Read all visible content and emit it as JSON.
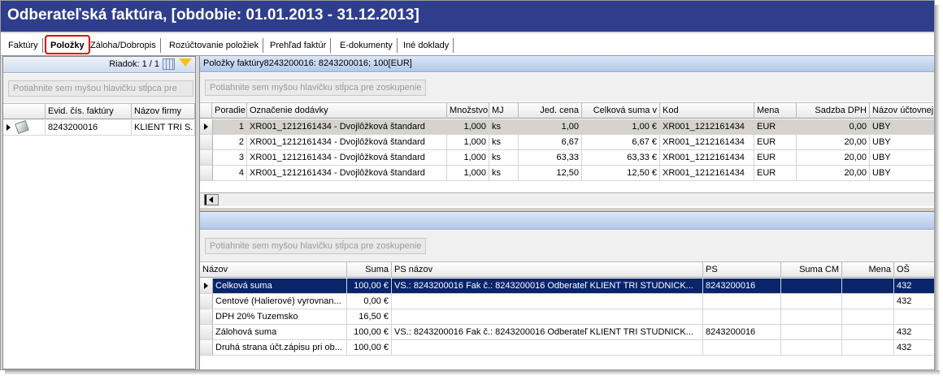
{
  "window": {
    "title": "Odberateľská faktúra, [obdobie: 01.01.2013 - 31.12.2013]"
  },
  "tabs": [
    "Faktúry",
    "Položky",
    "Záloha/Dobropis",
    "Rozúčtovanie položiek",
    "Prehľad faktúr",
    "E-dokumenty",
    "Iné doklady"
  ],
  "active_tab": "Položky",
  "left_panel": {
    "row_counter": "Riadok: 1 / 1",
    "group_placeholder": "Potiahnite sem myšou hlavičku stĺpca pre",
    "columns": [
      "Evid. čís. faktúry",
      "Názov firmy"
    ],
    "rows": [
      {
        "evid": "8243200016",
        "firma": "KLIENT TRI S."
      }
    ]
  },
  "items_panel": {
    "header": "Položky faktúry8243200016: 8243200016; 100[EUR]",
    "group_placeholder": "Potiahnite sem myšou hlavičku stĺpca pre zoskupenie",
    "columns": [
      "Poradie",
      "Označenie dodávky",
      "Množstvo",
      "MJ",
      "Jed. cena",
      "Celková suma v",
      "Kod",
      "Mena",
      "Sadzba DPH",
      "Názov účtovnej"
    ],
    "rows": [
      {
        "poradie": "1",
        "oznacenie": "XR001_1212161434 - Dvojlôžková štandard",
        "mnozstvo": "1,000",
        "mj": "ks",
        "jed_cena": "1,00",
        "celkova": "1,00 €",
        "kod": "XR001_1212161434",
        "mena": "EUR",
        "sadzba": "0,00",
        "nazov": "UBY"
      },
      {
        "poradie": "2",
        "oznacenie": "XR001_1212161434 - Dvojlôžková štandard",
        "mnozstvo": "1,000",
        "mj": "ks",
        "jed_cena": "6,67",
        "celkova": "6,67 €",
        "kod": "XR001_1212161434",
        "mena": "EUR",
        "sadzba": "20,00",
        "nazov": "UBY"
      },
      {
        "poradie": "3",
        "oznacenie": "XR001_1212161434 - Dvojlôžková štandard",
        "mnozstvo": "1,000",
        "mj": "ks",
        "jed_cena": "63,33",
        "celkova": "63,33 €",
        "kod": "XR001_1212161434",
        "mena": "EUR",
        "sadzba": "20,00",
        "nazov": "UBY"
      },
      {
        "poradie": "4",
        "oznacenie": "XR001_1212161434 - Dvojlôžková štandard",
        "mnozstvo": "1,000",
        "mj": "ks",
        "jed_cena": "12,50",
        "celkova": "12,50 €",
        "kod": "XR001_1212161434",
        "mena": "EUR",
        "sadzba": "20,00",
        "nazov": "UBY"
      }
    ]
  },
  "summary_panel": {
    "group_placeholder": "Potiahnite sem myšou hlavičku stĺpca pre zoskupenie",
    "columns": [
      "Názov",
      "Suma",
      "PS názov",
      "PS",
      "Suma CM",
      "Mena",
      "OŠ"
    ],
    "rows": [
      {
        "nazov": "Celková suma",
        "suma": "100,00 €",
        "ps_nazov": "VS.: 8243200016 Fak č.: 8243200016 Odberateľ KLIENT TRI STUDNICK...",
        "ps": "8243200016",
        "suma_cm": "",
        "mena": "",
        "os": "432"
      },
      {
        "nazov": "Centové (Halierové) vyrovnan...",
        "suma": "0,00 €",
        "ps_nazov": "",
        "ps": "",
        "suma_cm": "",
        "mena": "",
        "os": "432"
      },
      {
        "nazov": "DPH 20% Tuzemsko",
        "suma": "16,50 €",
        "ps_nazov": "",
        "ps": "",
        "suma_cm": "",
        "mena": "",
        "os": ""
      },
      {
        "nazov": "Zálohová suma",
        "suma": "100,00 €",
        "ps_nazov": "VS.: 8243200016 Fak č.: 8243200016 Odberateľ KLIENT TRI STUDNICK...",
        "ps": "8243200016",
        "suma_cm": "",
        "mena": "",
        "os": "432"
      },
      {
        "nazov": "Druhá strana účt.zápisu pri ob...",
        "suma": "100,00 €",
        "ps_nazov": "",
        "ps": "",
        "suma_cm": "",
        "mena": "",
        "os": "432"
      }
    ]
  }
}
